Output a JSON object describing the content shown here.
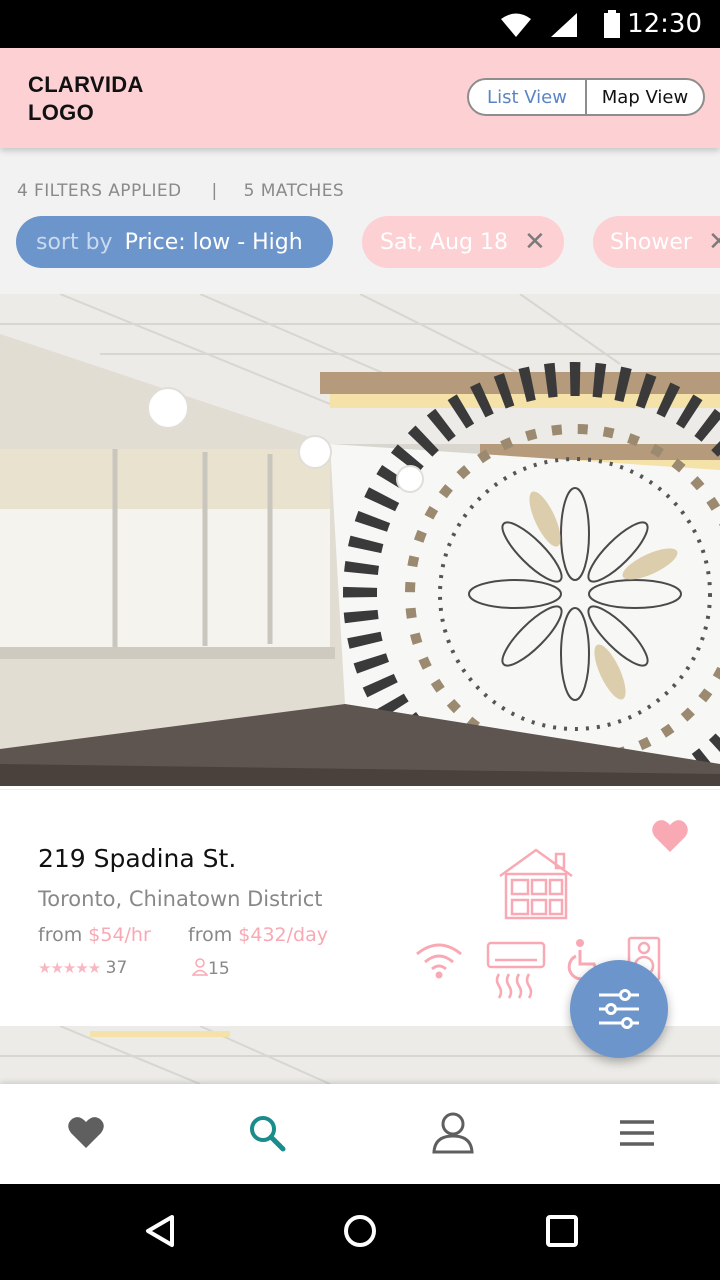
{
  "status_bar": {
    "time": "12:30"
  },
  "header": {
    "logo_line1": "CLARVIDA",
    "logo_line2": "LOGO",
    "list_view_label": "List View",
    "map_view_label": "Map View"
  },
  "filters": {
    "applied_text": "4 FILTERS APPLIED",
    "separator": "|",
    "matches_text": "5 MATCHES",
    "sort_key": "sort by",
    "sort_value": "Price: low - High",
    "chips": [
      {
        "label": "Sat, Aug 18",
        "close": "✕"
      },
      {
        "label": "Shower",
        "close": "✕"
      }
    ]
  },
  "listing": {
    "address": "219 Spadina St.",
    "district": "Toronto, Chinatown District",
    "price_hour_prefix": "from",
    "price_hour": "$54/hr",
    "price_day_prefix": "from",
    "price_day": "$432/day",
    "stars": "★★★★★",
    "review_count": "37",
    "capacity": "15",
    "amenities": [
      "house-icon",
      "wifi-icon",
      "air-conditioner-icon",
      "wheelchair-icon",
      "speaker-icon"
    ]
  },
  "colors": {
    "header_bg": "#fdd0d4",
    "accent_blue": "#6c95cb",
    "accent_pink": "#f8a9b4",
    "search_teal": "#1a8c8c"
  },
  "tabs": [
    "favorites-tab",
    "search-tab",
    "profile-tab",
    "menu-tab"
  ]
}
